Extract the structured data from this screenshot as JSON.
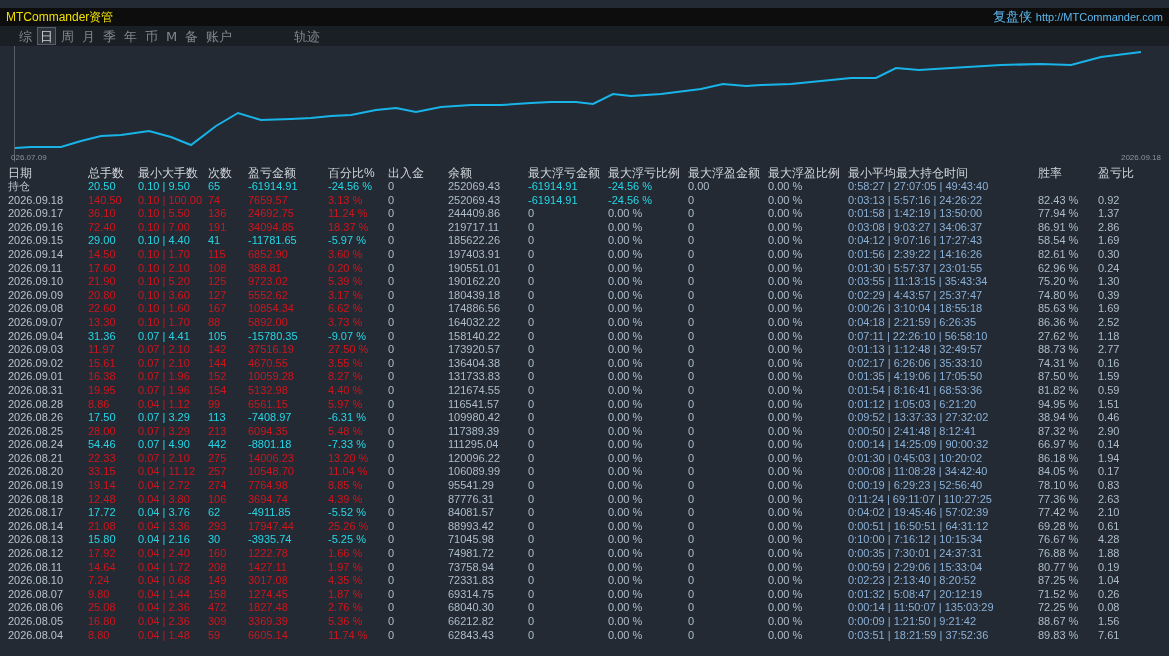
{
  "header": {
    "title": "MTCommander资管",
    "brand": "复盘侠",
    "link": "http://MTCommander.com"
  },
  "tabs": [
    {
      "label": "综",
      "selected": false
    },
    {
      "label": "日",
      "selected": true
    },
    {
      "label": "周",
      "selected": false
    },
    {
      "label": "月",
      "selected": false
    },
    {
      "label": "季",
      "selected": false
    },
    {
      "label": "年",
      "selected": false
    },
    {
      "label": "币",
      "selected": false
    },
    {
      "label": "M",
      "selected": false
    },
    {
      "label": "备",
      "selected": false
    },
    {
      "label": "账户",
      "selected": false
    },
    {
      "label": "轨迹",
      "selected": false
    }
  ],
  "chart": {
    "start_label": "026.07.09",
    "end_label": "2026.09.18"
  },
  "table": {
    "columns": [
      "日期",
      "总手数",
      "最小大手数",
      "次数",
      "盈亏金额",
      "百分比%",
      "出入金",
      "余额",
      "最大浮亏金额",
      "最大浮亏比例",
      "最大浮盈金额",
      "最大浮盈比例",
      "最小平均最大持仓时间",
      "胜率",
      "盈亏比"
    ],
    "rows": [
      {
        "kind": "loss",
        "float_alert": true,
        "cells": [
          "持仓",
          "20.50",
          "0.10 | 9.50",
          "65",
          "-61914.91",
          "-24.56 %",
          "0",
          "252069.43",
          "-61914.91",
          "-24.56 %",
          "0.00",
          "0.00 %",
          "0:58:27 | 27:07:05 | 49:43:40"
        ]
      },
      {
        "kind": "profit",
        "float_alert": true,
        "cells": [
          "2026.09.18",
          "140.50",
          "0.10 | 100.00",
          "74",
          "7659.57",
          "3.13 %",
          "0",
          "252069.43",
          "-61914.91",
          "-24.56 %",
          "0",
          "0.00 %",
          "0:03:13 | 5:57:16 | 24:26:22",
          "82.43 %",
          "0.92"
        ]
      },
      {
        "kind": "profit",
        "float_alert": false,
        "cells": [
          "2026.09.17",
          "36.10",
          "0.10 | 5.50",
          "136",
          "24692.75",
          "11.24 %",
          "0",
          "244409.86",
          "0",
          "0.00 %",
          "0",
          "0.00 %",
          "0:01:58 | 1:42:19 | 13:50:00",
          "77.94 %",
          "1.37"
        ]
      },
      {
        "kind": "profit",
        "float_alert": false,
        "cells": [
          "2026.09.16",
          "72.40",
          "0.10 | 7.00",
          "191",
          "34094.85",
          "18.37 %",
          "0",
          "219717.11",
          "0",
          "0.00 %",
          "0",
          "0.00 %",
          "0:03:08 | 9:03:27 | 34:06:37",
          "86.91 %",
          "2.86"
        ]
      },
      {
        "kind": "loss",
        "float_alert": false,
        "cells": [
          "2026.09.15",
          "29.00",
          "0.10 | 4.40",
          "41",
          "-11781.65",
          "-5.97 %",
          "0",
          "185622.26",
          "0",
          "0.00 %",
          "0",
          "0.00 %",
          "0:04:12 | 9:07:16 | 17:27:43",
          "58.54 %",
          "1.69"
        ]
      },
      {
        "kind": "profit",
        "float_alert": false,
        "cells": [
          "2026.09.14",
          "14.50",
          "0.10 | 1.70",
          "115",
          "6852.90",
          "3.60 %",
          "0",
          "197403.91",
          "0",
          "0.00 %",
          "0",
          "0.00 %",
          "0:01:56 | 2:39:22 | 14:16:26",
          "82.61 %",
          "0.30"
        ]
      },
      {
        "kind": "profit",
        "float_alert": false,
        "cells": [
          "2026.09.11",
          "17.60",
          "0.10 | 2.10",
          "108",
          "388.81",
          "0.20 %",
          "0",
          "190551.01",
          "0",
          "0.00 %",
          "0",
          "0.00 %",
          "0:01:30 | 5:57:37 | 23:01:55",
          "62.96 %",
          "0.24"
        ]
      },
      {
        "kind": "profit",
        "float_alert": false,
        "cells": [
          "2026.09.10",
          "21.90",
          "0.10 | 5.20",
          "125",
          "9723.02",
          "5.39 %",
          "0",
          "190162.20",
          "0",
          "0.00 %",
          "0",
          "0.00 %",
          "0:03:55 | 11:13:15 | 35:43:34",
          "75.20 %",
          "1.30"
        ]
      },
      {
        "kind": "profit",
        "float_alert": false,
        "cells": [
          "2026.09.09",
          "20.80",
          "0.10 | 3.60",
          "127",
          "5552.62",
          "3.17 %",
          "0",
          "180439.18",
          "0",
          "0.00 %",
          "0",
          "0.00 %",
          "0:02:29 | 4:43:57 | 25:37:47",
          "74.80 %",
          "0.39"
        ]
      },
      {
        "kind": "profit",
        "float_alert": false,
        "cells": [
          "2026.09.08",
          "22.60",
          "0.10 | 1.60",
          "167",
          "10854.34",
          "6.62 %",
          "0",
          "174886.56",
          "0",
          "0.00 %",
          "0",
          "0.00 %",
          "0:00:26 | 3:10:04 | 18:55:18",
          "85.63 %",
          "1.69"
        ]
      },
      {
        "kind": "profit",
        "float_alert": false,
        "cells": [
          "2026.09.07",
          "13.30",
          "0.10 | 1.70",
          "88",
          "5892.00",
          "3.73 %",
          "0",
          "164032.22",
          "0",
          "0.00 %",
          "0",
          "0.00 %",
          "0:04:18 | 2:21:59 | 6:26:35",
          "86.36 %",
          "2.52"
        ]
      },
      {
        "kind": "loss",
        "float_alert": false,
        "cells": [
          "2026.09.04",
          "31.36",
          "0.07 | 4.41",
          "105",
          "-15780.35",
          "-9.07 %",
          "0",
          "158140.22",
          "0",
          "0.00 %",
          "0",
          "0.00 %",
          "0:07:11 | 22:26:10 | 56:58:10",
          "27.62 %",
          "1.18"
        ]
      },
      {
        "kind": "profit",
        "float_alert": false,
        "cells": [
          "2026.09.03",
          "11.97",
          "0.07 | 2.10",
          "142",
          "37516.19",
          "27.50 %",
          "0",
          "173920.57",
          "0",
          "0.00 %",
          "0",
          "0.00 %",
          "0:01:13 | 1:12:48 | 32:49:57",
          "88.73 %",
          "2.77"
        ]
      },
      {
        "kind": "profit",
        "float_alert": false,
        "cells": [
          "2026.09.02",
          "15.61",
          "0.07 | 2.10",
          "144",
          "4670.55",
          "3.55 %",
          "0",
          "136404.38",
          "0",
          "0.00 %",
          "0",
          "0.00 %",
          "0:02:17 | 6:26:06 | 35:33:10",
          "74.31 %",
          "0.16"
        ]
      },
      {
        "kind": "profit",
        "float_alert": false,
        "cells": [
          "2026.09.01",
          "16.38",
          "0.07 | 1.96",
          "152",
          "10059.28",
          "8.27 %",
          "0",
          "131733.83",
          "0",
          "0.00 %",
          "0",
          "0.00 %",
          "0:01:35 | 4:19:06 | 17:05:50",
          "87.50 %",
          "1.59"
        ]
      },
      {
        "kind": "profit",
        "float_alert": false,
        "cells": [
          "2026.08.31",
          "19.95",
          "0.07 | 1.96",
          "154",
          "5132.98",
          "4.40 %",
          "0",
          "121674.55",
          "0",
          "0.00 %",
          "0",
          "0.00 %",
          "0:01:54 | 8:16:41 | 68:53:36",
          "81.82 %",
          "0.59"
        ]
      },
      {
        "kind": "profit",
        "float_alert": false,
        "cells": [
          "2026.08.28",
          "8.86",
          "0.04 | 1.12",
          "99",
          "6561.15",
          "5.97 %",
          "0",
          "116541.57",
          "0",
          "0.00 %",
          "0",
          "0.00 %",
          "0:01:12 | 1:05:03 | 6:21:20",
          "94.95 %",
          "1.51"
        ]
      },
      {
        "kind": "loss",
        "float_alert": false,
        "cells": [
          "2026.08.26",
          "17.50",
          "0.07 | 3.29",
          "113",
          "-7408.97",
          "-6.31 %",
          "0",
          "109980.42",
          "0",
          "0.00 %",
          "0",
          "0.00 %",
          "0:09:52 | 13:37:33 | 27:32:02",
          "38.94 %",
          "0.46"
        ]
      },
      {
        "kind": "profit",
        "float_alert": false,
        "cells": [
          "2026.08.25",
          "28.00",
          "0.07 | 3.29",
          "213",
          "6094.35",
          "5.48 %",
          "0",
          "117389.39",
          "0",
          "0.00 %",
          "0",
          "0.00 %",
          "0:00:50 | 2:41:48 | 8:12:41",
          "87.32 %",
          "2.90"
        ]
      },
      {
        "kind": "loss",
        "float_alert": false,
        "cells": [
          "2026.08.24",
          "54.46",
          "0.07 | 4.90",
          "442",
          "-8801.18",
          "-7.33 %",
          "0",
          "111295.04",
          "0",
          "0.00 %",
          "0",
          "0.00 %",
          "0:00:14 | 14:25:09 | 90:00:32",
          "66.97 %",
          "0.14"
        ]
      },
      {
        "kind": "profit",
        "float_alert": false,
        "cells": [
          "2026.08.21",
          "22.33",
          "0.07 | 2.10",
          "275",
          "14006.23",
          "13.20 %",
          "0",
          "120096.22",
          "0",
          "0.00 %",
          "0",
          "0.00 %",
          "0:01:30 | 0:45:03 | 10:20:02",
          "86.18 %",
          "1.94"
        ]
      },
      {
        "kind": "profit",
        "float_alert": false,
        "cells": [
          "2026.08.20",
          "33.15",
          "0.04 | 11.12",
          "257",
          "10548.70",
          "11.04 %",
          "0",
          "106089.99",
          "0",
          "0.00 %",
          "0",
          "0.00 %",
          "0:00:08 | 11:08:28 | 34:42:40",
          "84.05 %",
          "0.17"
        ]
      },
      {
        "kind": "profit",
        "float_alert": false,
        "cells": [
          "2026.08.19",
          "19.14",
          "0.04 | 2.72",
          "274",
          "7764.98",
          "8.85 %",
          "0",
          "95541.29",
          "0",
          "0.00 %",
          "0",
          "0.00 %",
          "0:00:19 | 6:29:23 | 52:56:40",
          "78.10 %",
          "0.83"
        ]
      },
      {
        "kind": "profit",
        "float_alert": false,
        "cells": [
          "2026.08.18",
          "12.48",
          "0.04 | 3.80",
          "106",
          "3694.74",
          "4.39 %",
          "0",
          "87776.31",
          "0",
          "0.00 %",
          "0",
          "0.00 %",
          "0:11:24 | 69:11:07 | 110:27:25",
          "77.36 %",
          "2.63"
        ]
      },
      {
        "kind": "loss",
        "float_alert": false,
        "cells": [
          "2026.08.17",
          "17.72",
          "0.04 | 3.76",
          "62",
          "-4911.85",
          "-5.52 %",
          "0",
          "84081.57",
          "0",
          "0.00 %",
          "0",
          "0.00 %",
          "0:04:02 | 19:45:46 | 57:02:39",
          "77.42 %",
          "2.10"
        ]
      },
      {
        "kind": "profit",
        "float_alert": false,
        "cells": [
          "2026.08.14",
          "21.08",
          "0.04 | 3.36",
          "293",
          "17947.44",
          "25.26 %",
          "0",
          "88993.42",
          "0",
          "0.00 %",
          "0",
          "0.00 %",
          "0:00:51 | 16:50:51 | 64:31:12",
          "69.28 %",
          "0.61"
        ]
      },
      {
        "kind": "loss",
        "float_alert": false,
        "cells": [
          "2026.08.13",
          "15.80",
          "0.04 | 2.16",
          "30",
          "-3935.74",
          "-5.25 %",
          "0",
          "71045.98",
          "0",
          "0.00 %",
          "0",
          "0.00 %",
          "0:10:00 | 7:16:12 | 10:15:34",
          "76.67 %",
          "4.28"
        ]
      },
      {
        "kind": "profit",
        "float_alert": false,
        "cells": [
          "2026.08.12",
          "17.92",
          "0.04 | 2.40",
          "160",
          "1222.78",
          "1.66 %",
          "0",
          "74981.72",
          "0",
          "0.00 %",
          "0",
          "0.00 %",
          "0:00:35 | 7:30:01 | 24:37:31",
          "76.88 %",
          "1.88"
        ]
      },
      {
        "kind": "profit",
        "float_alert": false,
        "cells": [
          "2026.08.11",
          "14.64",
          "0.04 | 1.72",
          "208",
          "1427.11",
          "1.97 %",
          "0",
          "73758.94",
          "0",
          "0.00 %",
          "0",
          "0.00 %",
          "0:00:59 | 2:29:06 | 15:33:04",
          "80.77 %",
          "0.19"
        ]
      },
      {
        "kind": "profit",
        "float_alert": false,
        "cells": [
          "2026.08.10",
          "7.24",
          "0.04 | 0.68",
          "149",
          "3017.08",
          "4.35 %",
          "0",
          "72331.83",
          "0",
          "0.00 %",
          "0",
          "0.00 %",
          "0:02:23 | 2:13:40 | 8:20:52",
          "87.25 %",
          "1.04"
        ]
      },
      {
        "kind": "profit",
        "float_alert": false,
        "cells": [
          "2026.08.07",
          "9.80",
          "0.04 | 1.44",
          "158",
          "1274.45",
          "1.87 %",
          "0",
          "69314.75",
          "0",
          "0.00 %",
          "0",
          "0.00 %",
          "0:01:32 | 5:08:47 | 20:12:19",
          "71.52 %",
          "0.26"
        ]
      },
      {
        "kind": "profit",
        "float_alert": false,
        "cells": [
          "2026.08.06",
          "25.08",
          "0.04 | 2.36",
          "472",
          "1827.48",
          "2.76 %",
          "0",
          "68040.30",
          "0",
          "0.00 %",
          "0",
          "0.00 %",
          "0:00:14 | 11:50:07 | 135:03:29",
          "72.25 %",
          "0.08"
        ]
      },
      {
        "kind": "profit",
        "float_alert": false,
        "cells": [
          "2026.08.05",
          "16.80",
          "0.04 | 2.36",
          "309",
          "3369.39",
          "5.36 %",
          "0",
          "66212.82",
          "0",
          "0.00 %",
          "0",
          "0.00 %",
          "0:00:09 | 1:21:50 | 9:21:42",
          "88.67 %",
          "1.56"
        ]
      },
      {
        "kind": "profit",
        "float_alert": false,
        "cells": [
          "2026.08.04",
          "8.80",
          "0.04 | 1.48",
          "59",
          "6605.14",
          "11.74 %",
          "0",
          "62843.43",
          "0",
          "0.00 %",
          "0",
          "0.00 %",
          "0:03:51 | 18:21:59 | 37:52:36",
          "89.83 %",
          "7.61"
        ]
      }
    ]
  }
}
